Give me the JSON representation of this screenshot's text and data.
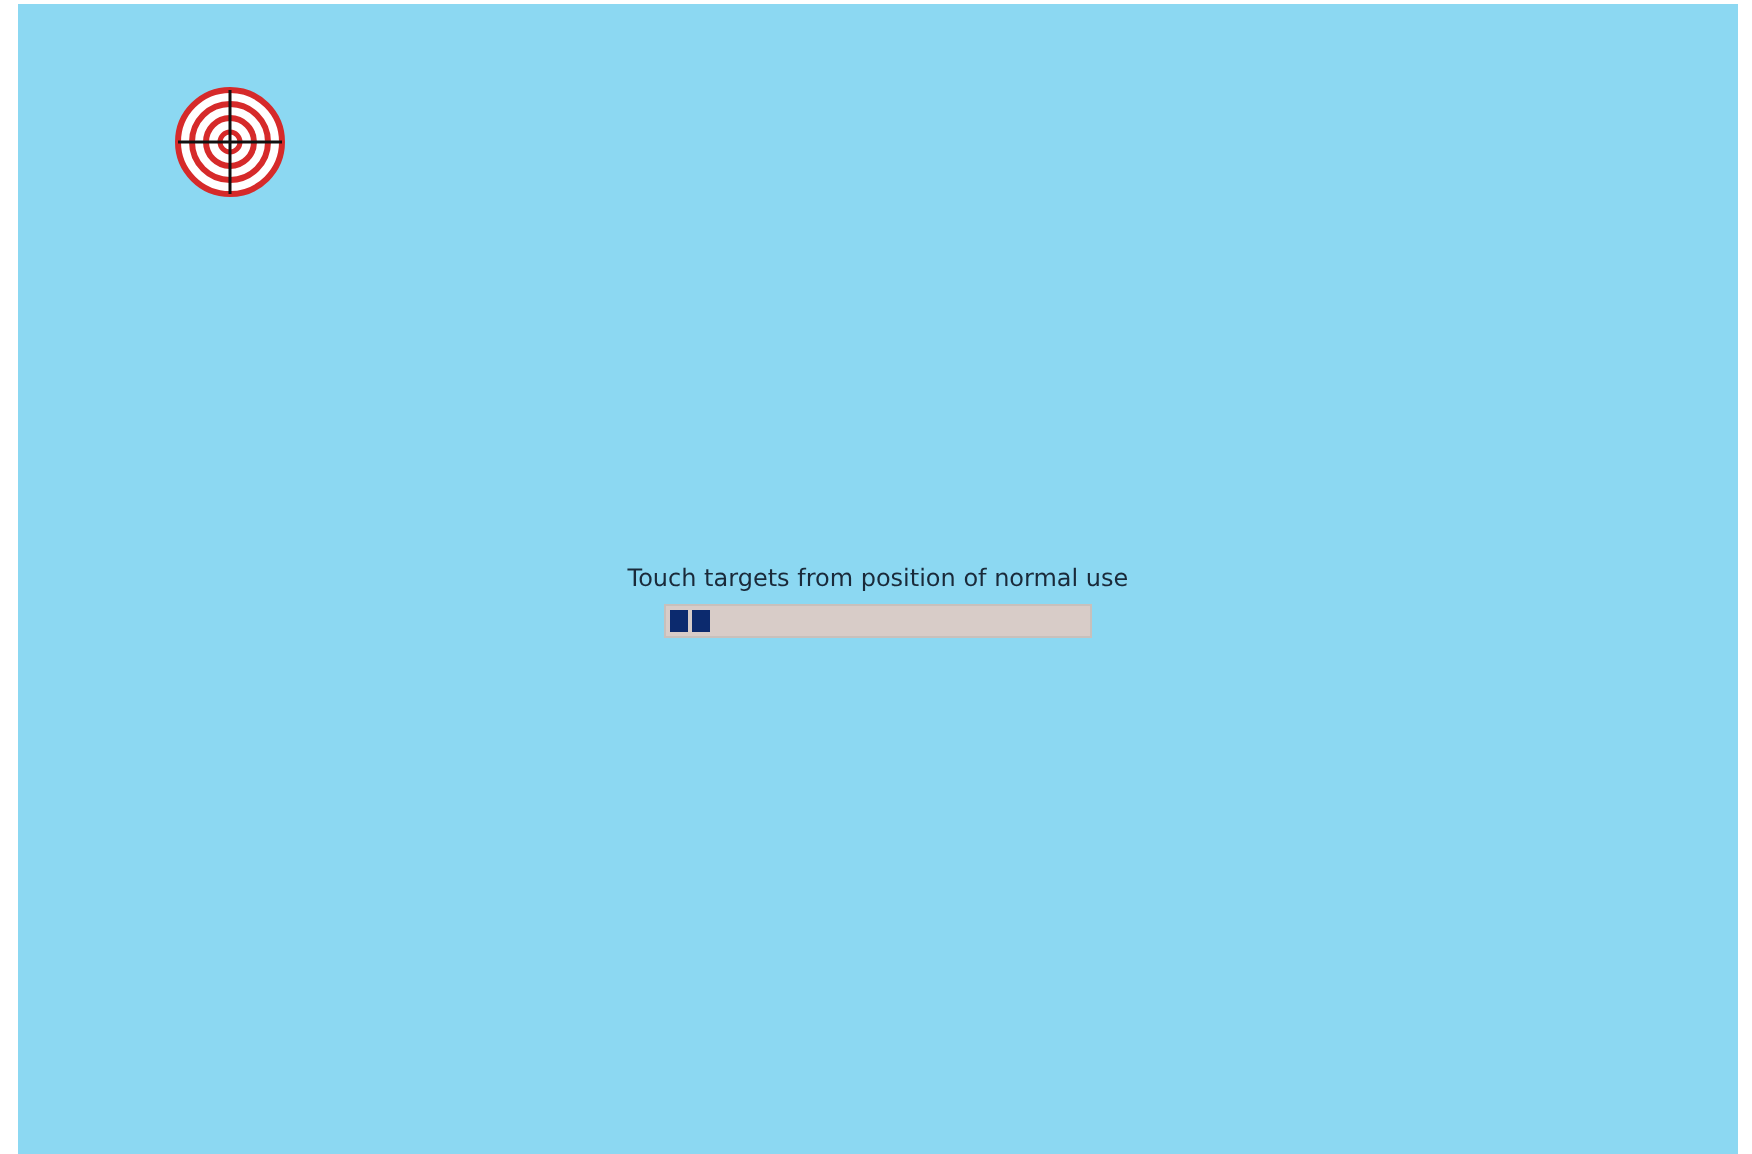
{
  "instruction": "Touch targets from position of normal use",
  "progress": {
    "level": 0.1
  }
}
